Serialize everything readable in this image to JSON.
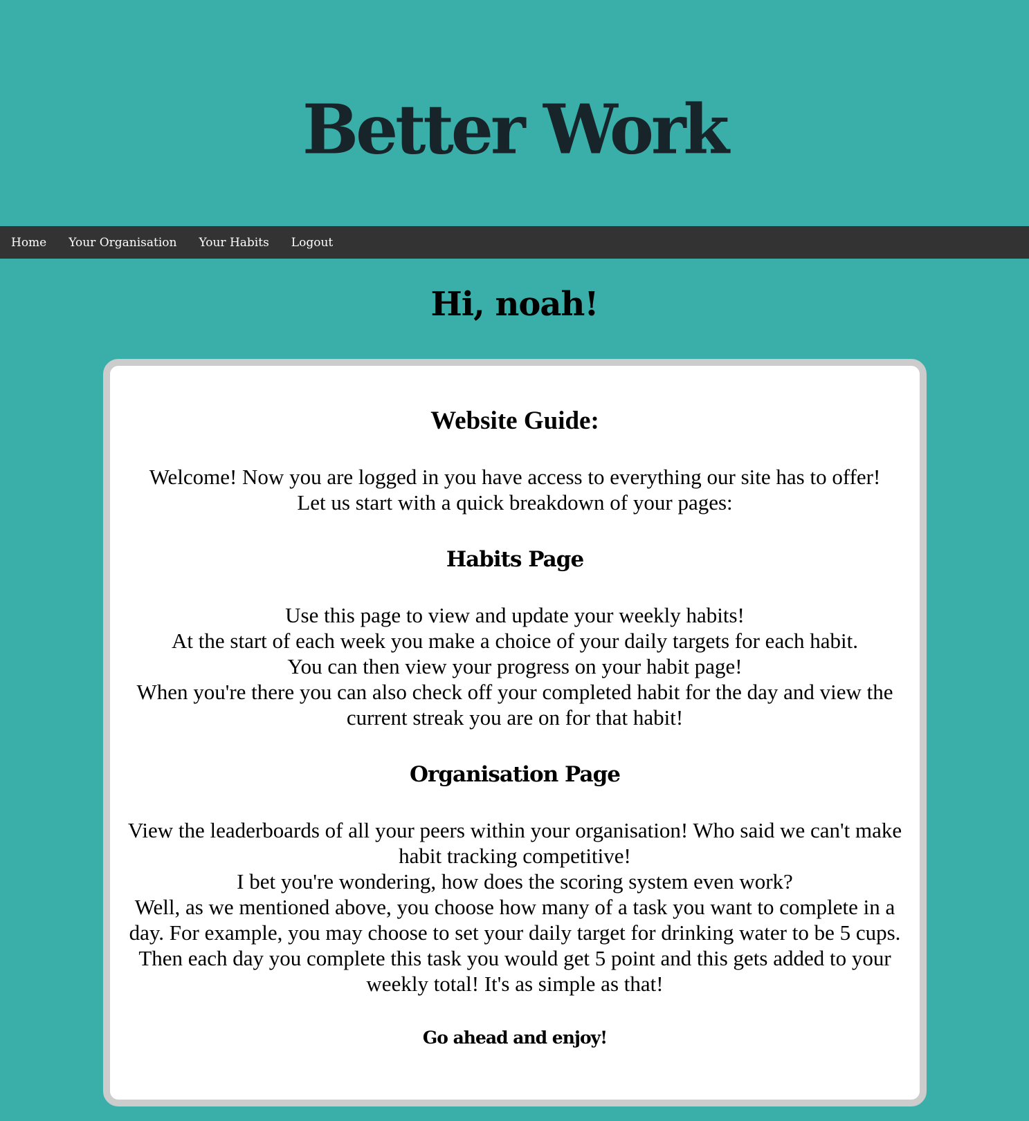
{
  "header": {
    "brand": "Better Work"
  },
  "nav": {
    "items": [
      {
        "label": "Home"
      },
      {
        "label": "Your Organisation"
      },
      {
        "label": "Your Habits"
      },
      {
        "label": "Logout"
      }
    ]
  },
  "greeting": "Hi, noah!",
  "guide": {
    "title": "Website Guide:",
    "intro_lines": [
      "Welcome! Now you are logged in you have access to everything our site has to offer!",
      "Let us start with a quick breakdown of your pages:"
    ],
    "habits_heading": "Habits Page",
    "habits_lines": [
      "Use this page to view and update your weekly habits!",
      "At the start of each week you make a choice of your daily targets for each habit.",
      "You can then view your progress on your habit page!",
      "When you're there you can also check off your completed habit for the day and view the current streak you are on for that habit!"
    ],
    "org_heading": "Organisation Page",
    "org_lines": [
      "View the leaderboards of all your peers within your organisation! Who said we can't make habit tracking competitive!",
      "I bet you're wondering, how does the scoring system even work?",
      "Well, as we mentioned above, you choose how many of a task you want to complete in a day. For example, you may choose to set your daily target for drinking water to be 5 cups. Then each day you complete this task you would get 5 point and this gets added to your weekly total! It's as simple as that!"
    ],
    "outro": "Go ahead and enjoy!"
  },
  "colors": {
    "background": "#3aafa9",
    "brand_text": "#17252a",
    "navbar": "#333333",
    "card_border": "#cccccc"
  }
}
